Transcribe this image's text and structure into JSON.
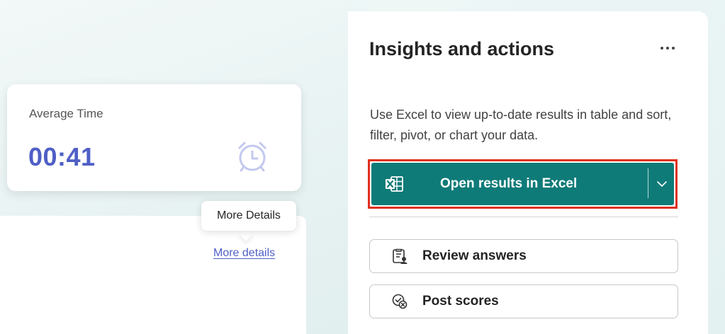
{
  "stat_card": {
    "label": "Average Time",
    "value": "00:41",
    "icon": "alarm-clock-icon"
  },
  "tooltip": {
    "text": "More Details"
  },
  "more_link": {
    "text": "More details"
  },
  "panel": {
    "title": "Insights and actions",
    "more_icon": "more-horizontal-icon",
    "description": "Use Excel to view up-to-date results in table and sort, filter, pivot, or chart your data.",
    "excel_button": {
      "label": "Open results in Excel",
      "icon": "excel-icon",
      "chevron_icon": "chevron-down-icon"
    },
    "actions": [
      {
        "label": "Review answers",
        "icon": "review-answers-icon"
      },
      {
        "label": "Post scores",
        "icon": "post-scores-icon"
      }
    ]
  },
  "colors": {
    "accent": "#4f5fc6",
    "excel_green": "#0f7b78",
    "highlight_border": "#e0301e"
  }
}
